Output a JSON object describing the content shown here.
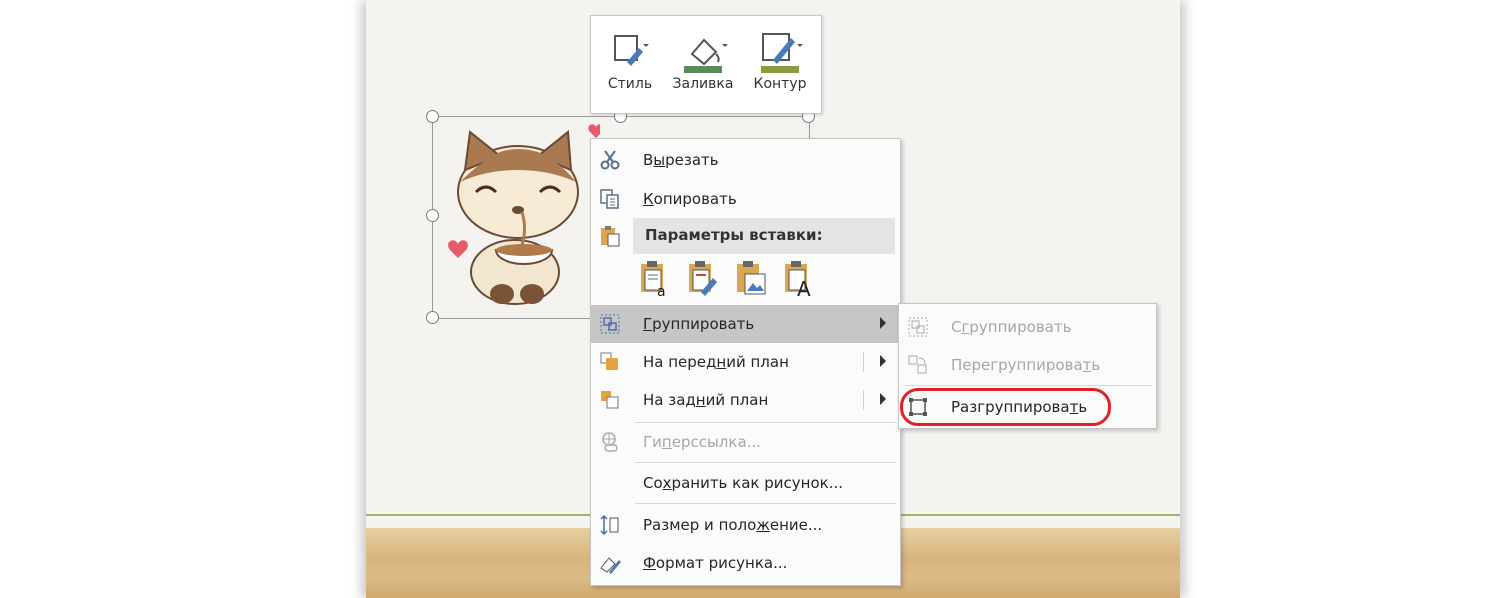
{
  "mini_toolbar": {
    "style_label": "Стиль",
    "fill_label": "Заливка",
    "outline_label": "Контур",
    "fill_color": "#5a8a5a",
    "outline_color": "#8b9a3a"
  },
  "context_menu": {
    "cut": {
      "pre": "В",
      "u": "ы",
      "post": "резать"
    },
    "copy": {
      "pre": "",
      "u": "К",
      "post": "опировать"
    },
    "paste_header": "Параметры вставки:",
    "group": {
      "pre": "",
      "u": "Г",
      "post": "руппировать"
    },
    "bring_front": {
      "pre": "На перед",
      "u": "н",
      "post": "ий план"
    },
    "send_back": {
      "pre": "На зад",
      "u": "н",
      "post": "ий план"
    },
    "hyperlink": {
      "pre": "Ги",
      "u": "п",
      "post": "ерссылка..."
    },
    "save_as": {
      "pre": "Со",
      "u": "х",
      "post": "ранить как рисунок..."
    },
    "size_pos": {
      "pre": "Размер и поло",
      "u": "ж",
      "post": "ение..."
    },
    "format": {
      "pre": "",
      "u": "Ф",
      "post": "ормат рисунка..."
    }
  },
  "submenu": {
    "group": {
      "pre": "С",
      "u": "г",
      "post": "руппировать"
    },
    "regroup": {
      "pre": "Перегруппирова",
      "u": "т",
      "post": "ь"
    },
    "ungroup": {
      "pre": "Разгруппирова",
      "u": "т",
      "post": "ь"
    }
  },
  "highlight_color": "#e32025"
}
